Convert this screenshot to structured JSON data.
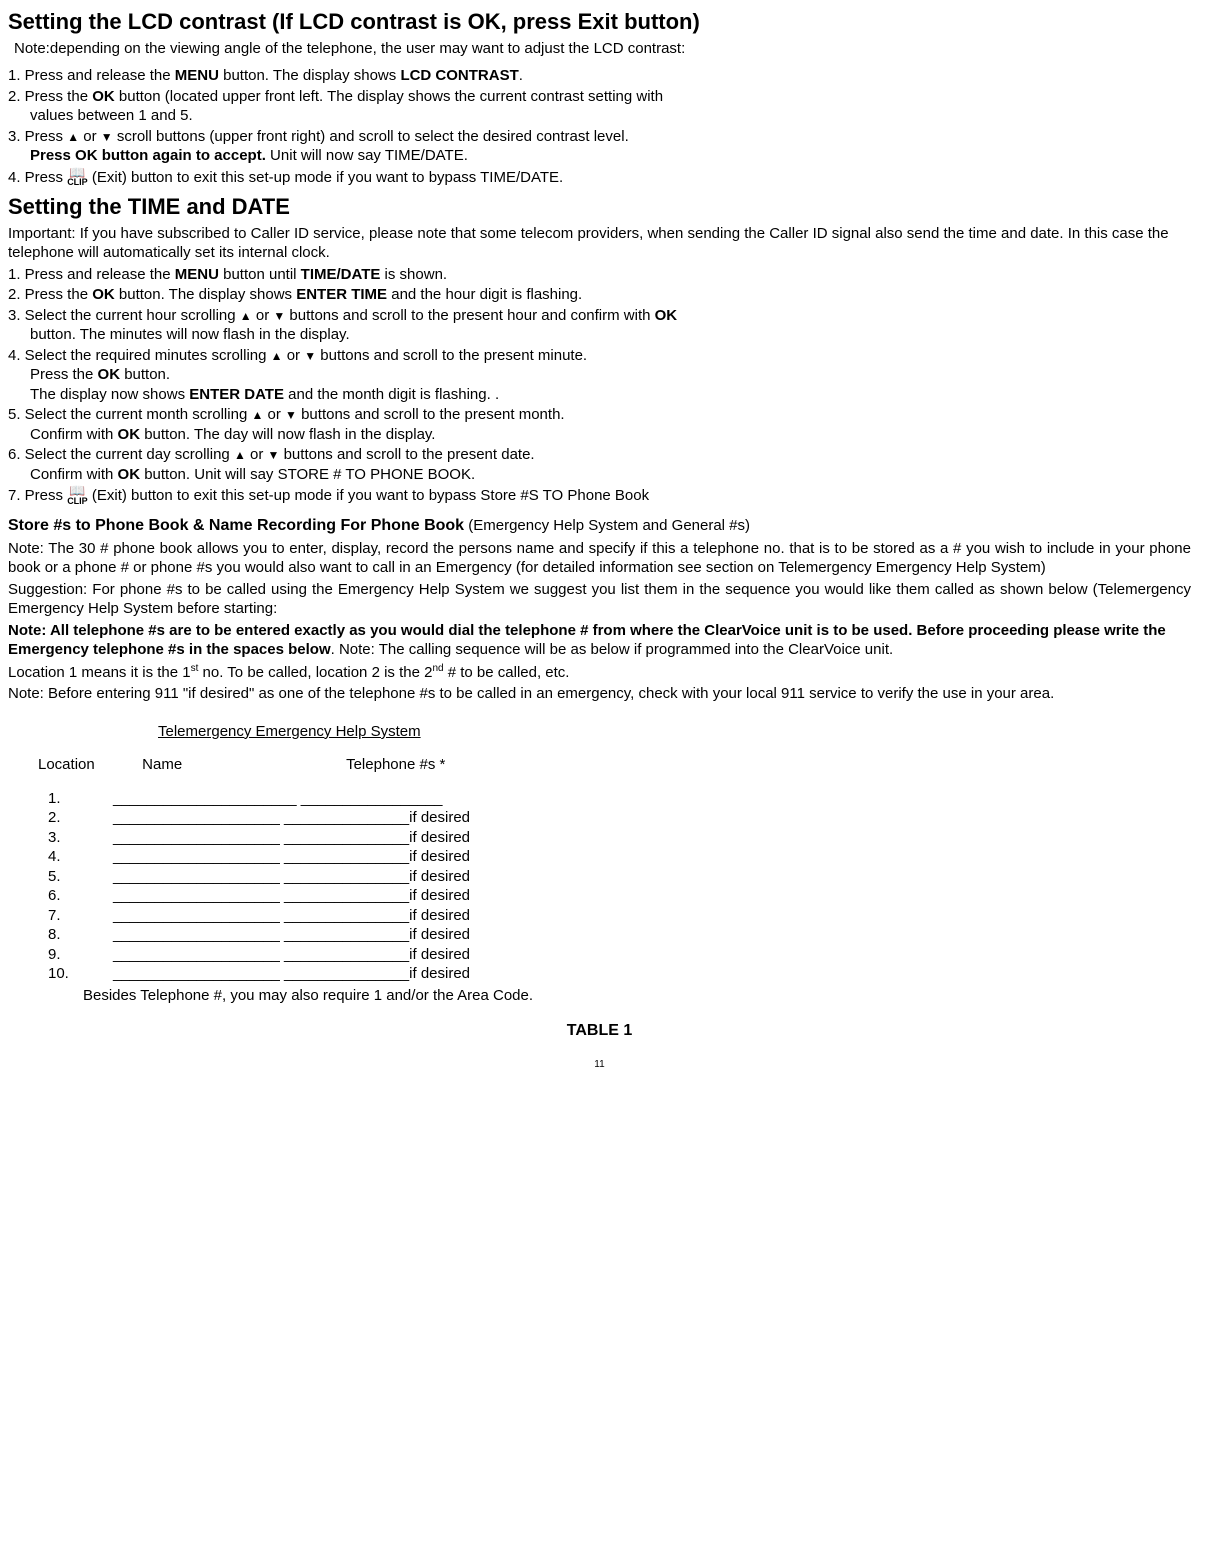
{
  "section1": {
    "title": "Setting the LCD contrast (If LCD contrast is OK, press Exit button)",
    "note": "Note:depending on the viewing angle of the telephone, the user may want to adjust the LCD contrast:",
    "step1_a": "1. Press and release the ",
    "step1_b": "MENU",
    "step1_c": " button. The display shows ",
    "step1_d": "LCD CONTRAST",
    "step1_e": ".",
    "step2_a": "2. Press the ",
    "step2_b": "OK",
    "step2_c": " button (located upper front left. The display shows the current contrast setting with",
    "step2_d": "values between 1 and 5.",
    "step3_a": "3. Press ",
    "step3_b": " or ",
    "step3_c": "  scroll buttons (upper front right) and scroll to select the desired contrast level.",
    "step3_d": "Press OK button again to accept.",
    "step3_e": " Unit will now say TIME/DATE.",
    "step4_a": "4. Press ",
    "step4_b": " (Exit) button to exit this set-up mode if you want to bypass TIME/DATE."
  },
  "section2": {
    "title": "Setting the TIME and DATE",
    "important": "Important: If you have subscribed to Caller ID service, please note that some telecom providers, when sending the Caller ID signal also send the time and date. In this case the telephone will automatically set its internal clock.",
    "s1_a": "1. Press and release the ",
    "s1_b": "MENU",
    "s1_c": " button until ",
    "s1_d": "TIME/DATE",
    "s1_e": " is shown.",
    "s2_a": "2. Press the ",
    "s2_b": "OK",
    "s2_c": " button. The display shows ",
    "s2_d": "ENTER TIME",
    "s2_e": " and the hour digit is flashing.",
    "s3_a": "3. Select the current hour scrolling ",
    "s3_b": " or ",
    "s3_c": " buttons and scroll to the present hour and confirm with ",
    "s3_d": "OK",
    "s3_e": "button. The minutes will now flash in the display.",
    "s4_a": "4. Select the required minutes scrolling ",
    "s4_b": " or ",
    "s4_c": " buttons and scroll to the present minute.",
    "s4_d": "Press the ",
    "s4_e": "OK",
    "s4_f": " button.",
    "s4_g": "The display now shows ",
    "s4_h": "ENTER DATE",
    "s4_i": " and the month digit is flashing. .",
    "s5_a": "5. Select the current month scrolling ",
    "s5_b": " or ",
    "s5_c": " buttons and scroll to the present month.",
    "s5_d": "Confirm with ",
    "s5_e": "OK",
    "s5_f": " button. The day will now flash in the display.",
    "s6_a": "6. Select the current day scrolling ",
    "s6_b": " or ",
    "s6_c": " buttons and scroll to the present date.",
    "s6_d": "Confirm with ",
    "s6_e": "OK",
    "s6_f": " button. Unit will say STORE # TO PHONE BOOK.",
    "s7_a": "7. Press ",
    "s7_b": " (Exit) button to exit this set-up mode if you want to bypass Store #S TO Phone Book"
  },
  "section3": {
    "head_a": "Store #s to Phone Book  & Name Recording For Phone ",
    "head_b": "Book",
    "head_c": " (Emergency Help System and General #s)",
    "p1": "Note: The  30 # phone book allows you to enter, display, record the persons name and specify if this a telephone no. that is to be stored as a # you wish to include in your phone book or a phone # or phone #s you would also want to call in an Emergency (for detailed information see section on Telemergency Emergency Help System)",
    "p2": "Suggestion: For phone #s to be called using the Emergency Help System we suggest you list them in the sequence you would like them called as shown below (Telemergency Emergency Help System before starting:",
    "p3_a": "Note: All telephone #s are to be entered exactly as you would dial the telephone # from where the ClearVoice unit is to be used. Before proceeding please write the Emergency telephone #s in the spaces below",
    "p3_b": ". Note: The calling sequence will be as below if programmed into the ClearVoice unit.",
    "p4_a": "Location 1 means it is the 1",
    "p4_b": "st",
    "p4_c": " no. To be called, location 2 is the 2",
    "p4_d": "nd",
    "p4_e": " # to be called, etc.",
    "p5": "Note: Before entering 911 \"if desired\" as one of the telephone #s to be called in an emergency, check with your local 911 service to verify the use in your area."
  },
  "table": {
    "title": "Telemergency Emergency Help System",
    "col1": "Location",
    "col2": "Name",
    "col3": "Telephone #s *",
    "rows": [
      {
        "num": "1.",
        "name_line": "______________________",
        "tel_line": "_________________",
        "suffix": ""
      },
      {
        "num": "2.",
        "name_line": "____________________",
        "tel_line": "_______________",
        "suffix": "if desired"
      },
      {
        "num": "3.",
        "name_line": "____________________",
        "tel_line": "_______________",
        "suffix": "if desired"
      },
      {
        "num": "4.",
        "name_line": "____________________",
        "tel_line": "_______________",
        "suffix": "if desired"
      },
      {
        "num": "5.",
        "name_line": "____________________",
        "tel_line": "_______________",
        "suffix": "if desired"
      },
      {
        "num": "6.",
        "name_line": "____________________",
        "tel_line": "_______________",
        "suffix": "if desired"
      },
      {
        "num": "7.",
        "name_line": "____________________",
        "tel_line": "_______________",
        "suffix": "if desired"
      },
      {
        "num": "8.",
        "name_line": "____________________",
        "tel_line": "_______________",
        "suffix": "if desired"
      },
      {
        "num": "9.",
        "name_line": "____________________",
        "tel_line": "_______________",
        "suffix": "if desired"
      },
      {
        "num": "10.",
        "name_line": "____________________",
        "tel_line": "_______________",
        "suffix": "if desired"
      }
    ],
    "after": "Besides Telephone #, you may also require 1 and/or the Area Code.",
    "label": "TABLE 1"
  },
  "page_number": "11",
  "icons": {
    "triangle_up": "▲",
    "triangle_down": "▼",
    "book": "📖",
    "clip": "CLIP"
  }
}
